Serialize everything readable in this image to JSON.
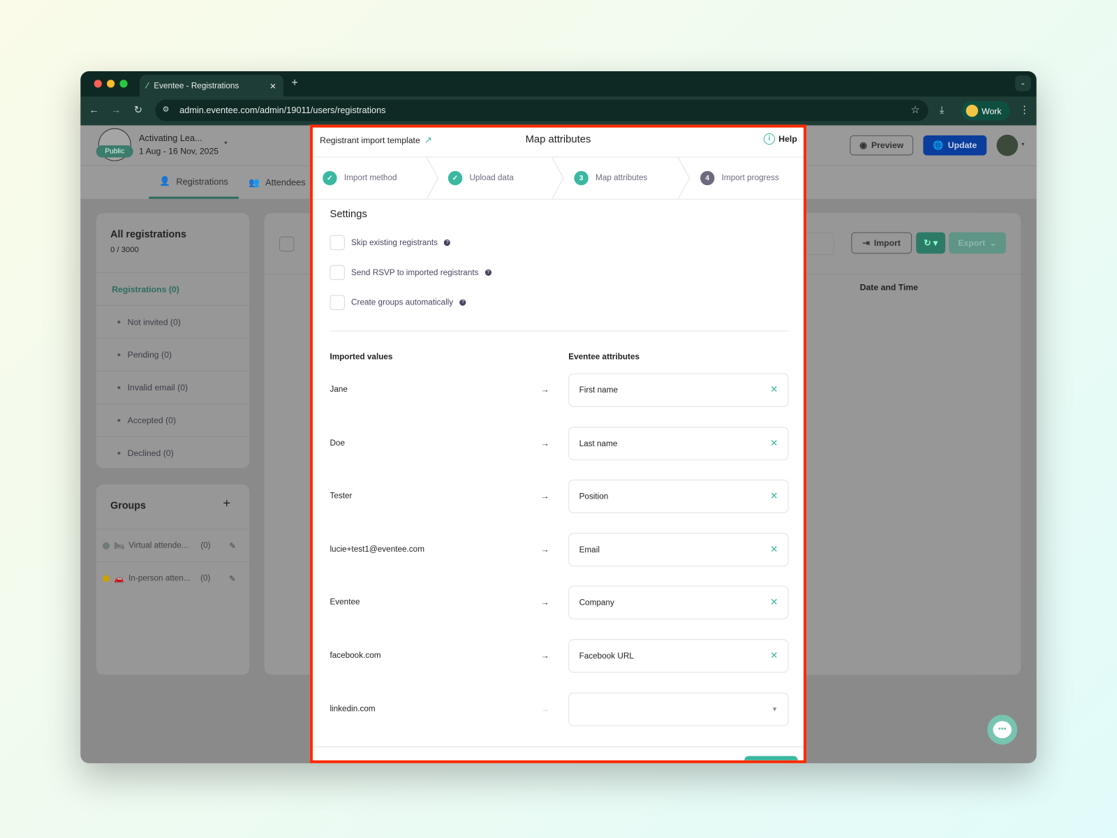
{
  "browser": {
    "tab_title": "Eventee - Registrations",
    "url": "admin.eventee.com/admin/19011/users/registrations",
    "profile_label": "Work"
  },
  "app": {
    "event_name": "Activating Lea...",
    "event_dates": "1 Aug - 16 Nov, 2025",
    "visibility_badge": "Public",
    "preview_label": "Preview",
    "update_label": "Update",
    "tabs": [
      {
        "label": "Registrations"
      },
      {
        "label": "Attendees"
      }
    ],
    "sidebar": {
      "title": "All registrations",
      "count": "0 / 3000",
      "items": [
        {
          "label": "Registrations (0)"
        },
        {
          "label": "Not invited (0)"
        },
        {
          "label": "Pending (0)"
        },
        {
          "label": "Invalid email (0)"
        },
        {
          "label": "Accepted (0)"
        },
        {
          "label": "Declined (0)"
        }
      ]
    },
    "groups": {
      "title": "Groups",
      "items": [
        {
          "emoji": "🛏",
          "name": "Virtual attende...",
          "count": "(0)",
          "color": "#6f7a7a"
        },
        {
          "emoji": "🚗",
          "name": "In-person atten...",
          "count": "(0)",
          "color": "#c9a20a"
        }
      ]
    },
    "toolbar": {
      "import_label": "Import",
      "export_label": "Export"
    },
    "table": {
      "column_date": "Date and Time"
    }
  },
  "modal": {
    "template_link": "Registrant import template",
    "title": "Map attributes",
    "help_label": "Help",
    "steps": [
      {
        "number": "1",
        "label": "Import method",
        "state": "done"
      },
      {
        "number": "2",
        "label": "Upload data",
        "state": "done"
      },
      {
        "number": "3",
        "label": "Map attributes",
        "state": "active"
      },
      {
        "number": "4",
        "label": "Import progress",
        "state": "pending"
      }
    ],
    "settings": {
      "title": "Settings",
      "options": [
        {
          "label": "Skip existing registrants",
          "checked": false
        },
        {
          "label": "Send RSVP to imported registrants",
          "checked": false
        },
        {
          "label": "Create groups automatically",
          "checked": false
        }
      ]
    },
    "mapping": {
      "col_imported": "Imported values",
      "col_attributes": "Eventee attributes",
      "rows": [
        {
          "value": "Jane",
          "attribute": "First name"
        },
        {
          "value": "Doe",
          "attribute": "Last name"
        },
        {
          "value": "Tester",
          "attribute": "Position"
        },
        {
          "value": "lucie+test1@eventee.com",
          "attribute": "Email"
        },
        {
          "value": "Eventee",
          "attribute": "Company"
        },
        {
          "value": "facebook.com",
          "attribute": "Facebook URL"
        },
        {
          "value": "linkedin.com",
          "attribute": ""
        }
      ]
    }
  },
  "colors": {
    "accent": "#3bb8a0",
    "highlight_border": "#ff2a00",
    "update_blue": "#0a3d9c"
  }
}
